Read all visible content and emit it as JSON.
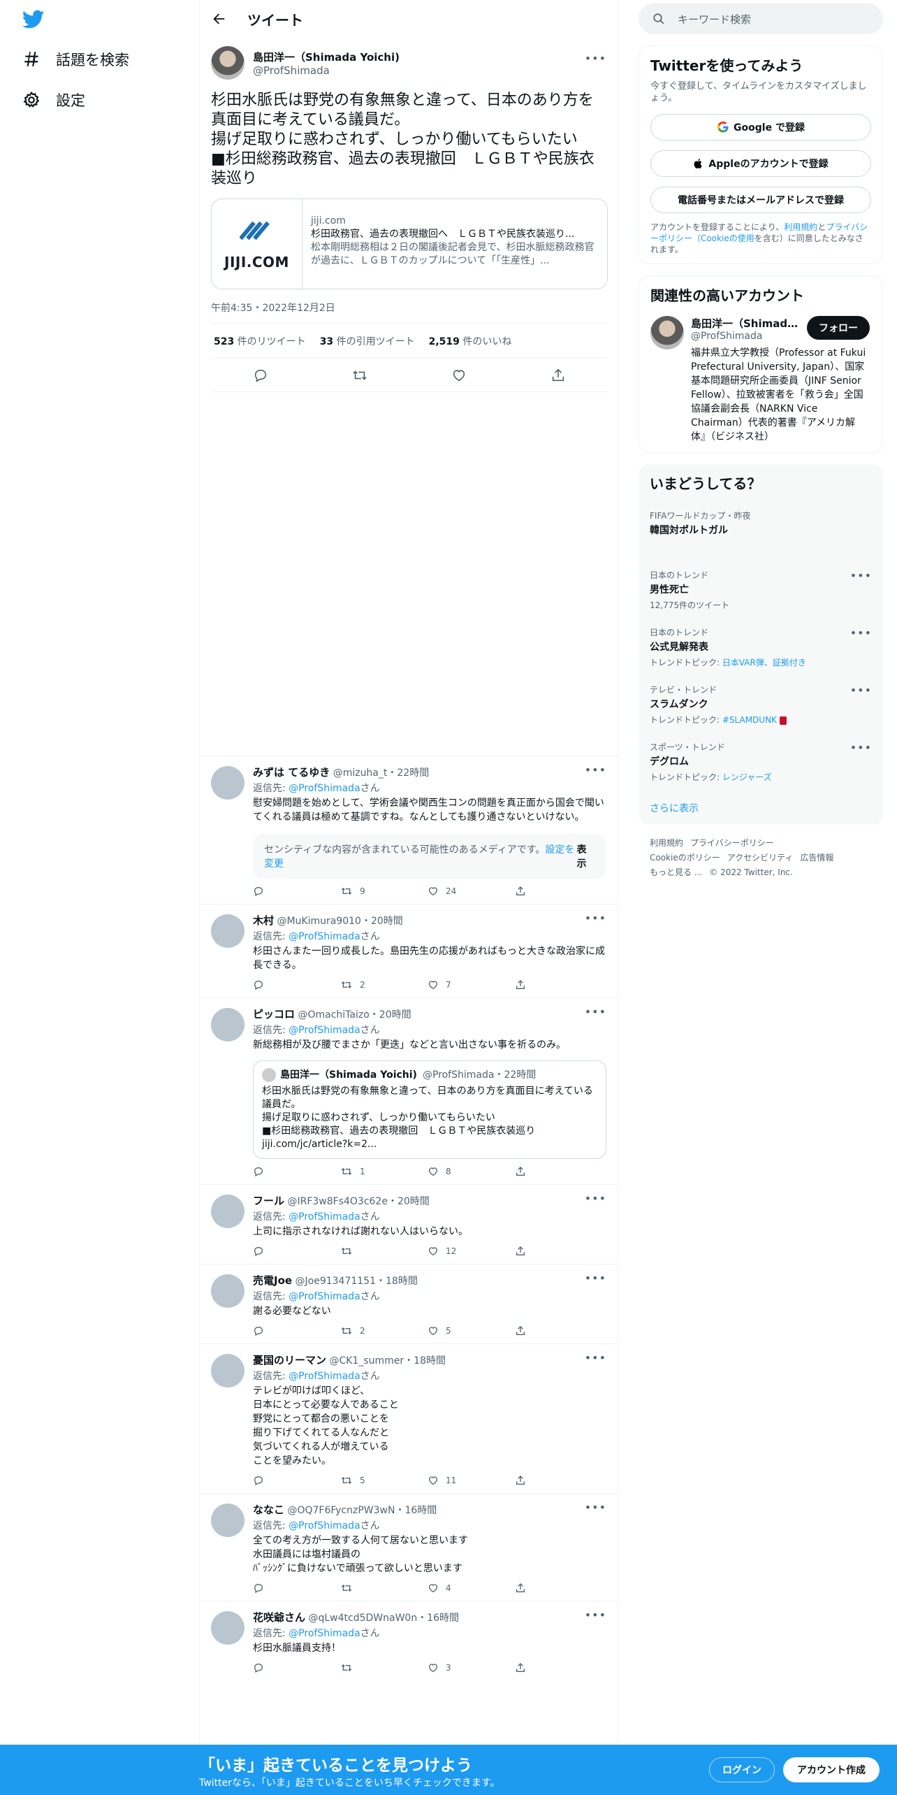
{
  "nav": {
    "logo": "twitter-bird-icon",
    "explore": "話題を検索",
    "settings": "設定"
  },
  "topbar": {
    "title": "ツイート"
  },
  "tweet": {
    "name": "島田洋一（Shimada Yoichi)",
    "handle": "@ProfShimada",
    "text": "杉田水脈氏は野党の有象無象と違って、日本のあり方を真面目に考えている議員だ。\n揚げ足取りに惑わされず、しっかり働いてもらいたい\n■杉田総務政務官、過去の表現撤回　ＬＧＢＴや民族衣装巡り",
    "card": {
      "domain": "jiji.com",
      "title": "杉田政務官、過去の表現撤回へ　ＬＧＢＴや民族衣装巡り...",
      "description": "松本剛明総務相は２日の閣議後記者会見で、杉田水脈総務政務官が過去に、ＬＧＢＴのカップルについて「「生産性」...",
      "logo_text": "JIJI.COM"
    },
    "timestamp": "午前4:35・2022年12月2日",
    "retweets": "523",
    "retweets_label": "件のリツイート",
    "quotes": "33",
    "quotes_label": "件の引用ツイート",
    "likes": "2,519",
    "likes_label": "件のいいね"
  },
  "replies": [
    {
      "name": "みずは てるゆき",
      "handle": "@mizuha_t",
      "time": "・22時間",
      "reply_to_prefix": "返信先: ",
      "reply_to": "@ProfShimada",
      "reply_to_suffix": "さん",
      "text": "慰安婦問題を始めとして、学術会議や関西生コンの問題を真正面から国会で聞いてくれる議員は極めて基調ですね。なんとしても護り通さないといけない。",
      "sensitive": "センシティブな内容が含まれている可能性のあるメディアです。",
      "sensitive_link": "設定を変更",
      "sensitive_show": "表示",
      "replies_count": "",
      "retweets_count": "9",
      "likes_count": "24"
    },
    {
      "name": "木村",
      "handle": "@MuKimura9010",
      "time": "・20時間",
      "reply_to_prefix": "返信先: ",
      "reply_to": "@ProfShimada",
      "reply_to_suffix": "さん",
      "text": "杉田さんまた一回り成長した。島田先生の応援があればもっと大きな政治家に成長できる。",
      "retweets_count": "2",
      "likes_count": "7"
    },
    {
      "name": "ピッコロ",
      "handle": "@OmachiTaizo",
      "time": "・20時間",
      "reply_to_prefix": "返信先: ",
      "reply_to": "@ProfShimada",
      "reply_to_suffix": "さん",
      "text": "新総務相が及び腰でまさか「更迭」などと言い出さない事を祈るのみ。",
      "quote": {
        "name": "島田洋一（Shimada Yoichi)",
        "handle": "@ProfShimada",
        "time": "・22時間",
        "text": "杉田水脈氏は野党の有象無象と違って、日本のあり方を真面目に考えている議員だ。\n揚げ足取りに惑わされず、しっかり働いてもらいたい\n■杉田総務政務官、過去の表現撤回　ＬＧＢＴや民族衣装巡り\njiji.com/jc/article?k=2..."
      },
      "retweets_count": "1",
      "likes_count": "8"
    },
    {
      "name": "フール",
      "handle": "@IRF3w8Fs4O3c62e",
      "time": "・20時間",
      "reply_to_prefix": "返信先: ",
      "reply_to": "@ProfShimada",
      "reply_to_suffix": "さん",
      "text": "上司に指示されなければ謝れない人はいらない。",
      "retweets_count": "",
      "likes_count": "12"
    },
    {
      "name": "売電Joe",
      "handle": "@Joe913471151",
      "time": "・18時間",
      "reply_to_prefix": "返信先: ",
      "reply_to": "@ProfShimada",
      "reply_to_suffix": "さん",
      "text": "謝る必要などない",
      "retweets_count": "2",
      "likes_count": "5"
    },
    {
      "name": "憂国のリーマン",
      "handle": "@CK1_summer",
      "time": "・18時間",
      "reply_to_prefix": "返信先: ",
      "reply_to": "@ProfShimada",
      "reply_to_suffix": "さん",
      "text": "テレビが叩けば叩くほど、\n日本にとって必要な人であること\n野党にとって都合の悪いことを\n掘り下げてくれてる人なんだと\n気づいてくれる人が増えている\nことを望みたい。",
      "retweets_count": "5",
      "likes_count": "11"
    },
    {
      "name": "ななこ",
      "handle": "@OQ7F6FycnzPW3wN",
      "time": "・16時間",
      "reply_to_prefix": "返信先: ",
      "reply_to": "@ProfShimada",
      "reply_to_suffix": "さん",
      "text": "全ての考え方が一致する人何て居ないと思います\n水田議員には塩村議員の\nﾊﾞｯｼﾝｸﾞに負けないで頑張って欲しいと思います",
      "retweets_count": "",
      "likes_count": "4"
    },
    {
      "name": "花咲爺さん",
      "handle": "@qLw4tcd5DWnaW0n",
      "time": "・16時間",
      "reply_to_prefix": "返信先: ",
      "reply_to": "@ProfShimada",
      "reply_to_suffix": "さん",
      "text": "杉田水脈議員支持！",
      "retweets_count": "",
      "likes_count": "3"
    }
  ],
  "sidebar": {
    "search_placeholder": "キーワード検索",
    "signup": {
      "title": "Twitterを使ってみよう",
      "subtitle": "今すぐ登録して、タイムラインをカスタマイズしましょう。",
      "google": "Google で登録",
      "apple": "Appleのアカウントで登録",
      "phone": "電話番号またはメールアドレスで登録",
      "terms_1": "アカウントを登録することにより、",
      "terms_link1": "利用規約",
      "terms_2": "と",
      "terms_link2": "プライバシーポリシー（Cookieの使用",
      "terms_3": "を含む）に同意したとみなされます。"
    },
    "related": {
      "title": "関連性の高いアカウント",
      "name": "島田洋一（Shimada ...",
      "handle": "@ProfShimada",
      "follow": "フォロー",
      "bio": "福井県立大学教授（Professor at Fukui Prefectural University, Japan）、国家基本問題研究所企画委員（JINF Senior Fellow）、拉致被害者を「救う会」全国協議会副会長（NARKN Vice Chairman）代表的著書『アメリカ解体』（ビジネス社）"
    },
    "trends": {
      "title": "いまどうしてる？",
      "items": [
        {
          "context": "FIFAワールドカップ・昨夜",
          "name": "韓国対ポルトガル",
          "sub_label": "",
          "sub": ""
        },
        {
          "context": "日本のトレンド",
          "name": "男性死亡",
          "sub_label": "12,775件のツイート",
          "sub": ""
        },
        {
          "context": "日本のトレンド",
          "name": "公式見解発表",
          "sub_label": "トレンドトピック: ",
          "sub": "日本VAR弾、証拠付き"
        },
        {
          "context": "テレビ・トレンド",
          "name": "スラムダンク",
          "sub_label": "トレンドトピック: ",
          "sub": "#SLAMDUNK"
        },
        {
          "context": "スポーツ・トレンド",
          "name": "デグロム",
          "sub_label": "トレンドトピック: ",
          "sub": "レンジャーズ"
        }
      ],
      "show_more": "さらに表示"
    },
    "footer": {
      "terms": "利用規約",
      "privacy": "プライバシーポリシー",
      "cookie": "Cookieのポリシー",
      "accessibility": "アクセシビリティ",
      "ads": "広告情報",
      "more": "もっと見る ...",
      "copyright": "© 2022 Twitter, Inc."
    }
  },
  "bottombar": {
    "title": "「いま」起きていることを見つけよう",
    "subtitle": "Twitterなら、「いま」起きていることをいち早くチェックできます。",
    "login": "ログイン",
    "signup": "アカウント作成"
  },
  "colors": {
    "accent": "#1d9bf0",
    "text": "#0f1419",
    "muted": "#536471",
    "border": "#eff3f4"
  }
}
